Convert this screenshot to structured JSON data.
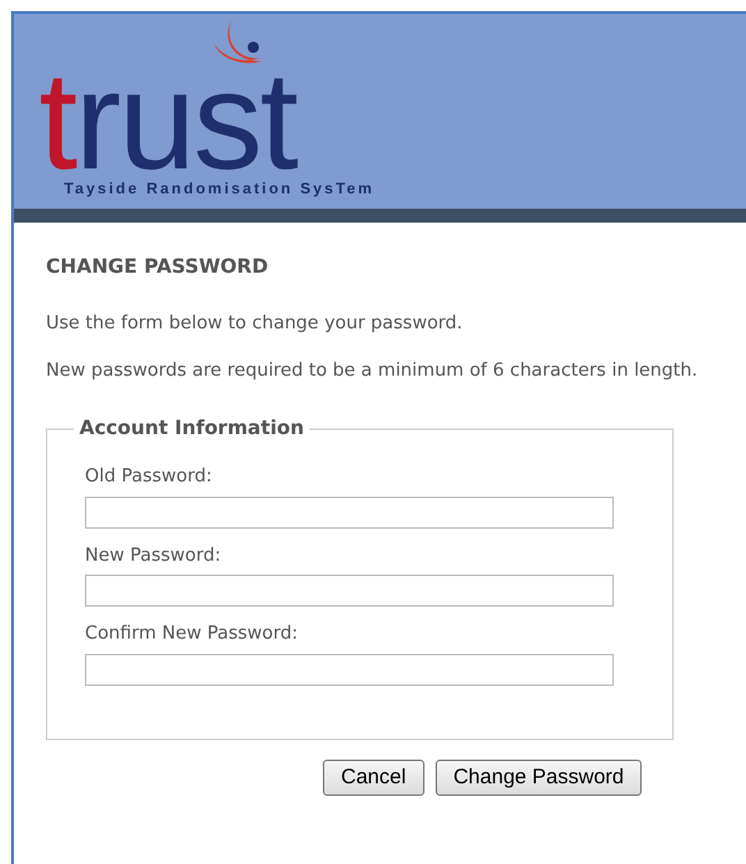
{
  "logo": {
    "letters": [
      {
        "text": "t",
        "color": "#c0152a"
      },
      {
        "text": "rust",
        "color": "#1f2f6e"
      }
    ],
    "subtitle": "Tayside Randomisation SysTem"
  },
  "heading": "CHANGE PASSWORD",
  "intro": "Use the form below to change your password.",
  "rule": "New passwords are required to be a minimum of 6 characters in length.",
  "fieldset": {
    "legend": "Account Information",
    "fields": [
      {
        "label": "Old Password:"
      },
      {
        "label": "New Password:"
      },
      {
        "label": "Confirm New Password:"
      }
    ]
  },
  "buttons": [
    "Cancel",
    "Change Password"
  ]
}
